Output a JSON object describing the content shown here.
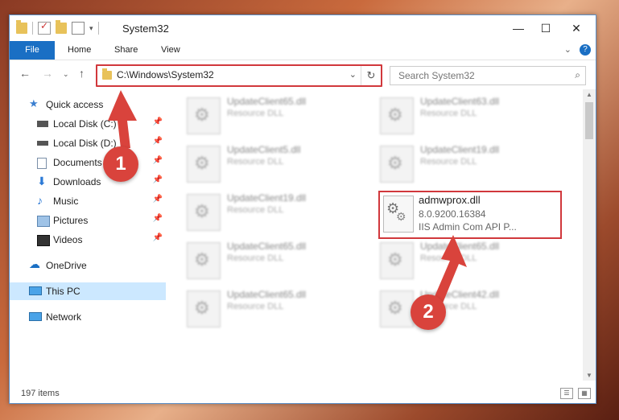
{
  "window": {
    "title": "System32",
    "controls": {
      "minimize": "—",
      "maximize": "☐",
      "close": "✕"
    }
  },
  "ribbon": {
    "tabs": [
      "File",
      "Home",
      "Share",
      "View"
    ],
    "help_label": "?"
  },
  "address": {
    "path": "C:\\Windows\\System32",
    "search_placeholder": "Search System32"
  },
  "sidebar": {
    "quick_access": "Quick access",
    "items": [
      {
        "label": "Local Disk (C:)",
        "icon": "drive-icon"
      },
      {
        "label": "Local Disk (D:)",
        "icon": "drive-icon"
      },
      {
        "label": "Documents",
        "icon": "documents-icon"
      },
      {
        "label": "Downloads",
        "icon": "download-icon"
      },
      {
        "label": "Music",
        "icon": "music-icon"
      },
      {
        "label": "Pictures",
        "icon": "pictures-icon"
      },
      {
        "label": "Videos",
        "icon": "videos-icon"
      }
    ],
    "onedrive": "OneDrive",
    "this_pc": "This PC",
    "network": "Network"
  },
  "files": [
    {
      "name": "UpdateClient65.dll",
      "desc": "Resource DLL"
    },
    {
      "name": "UpdateClient63.dll",
      "desc": "Resource DLL"
    },
    {
      "name": "UpdateClient5.dll",
      "desc": "Resource DLL"
    },
    {
      "name": "UpdateClient19.dll",
      "desc": "Resource DLL"
    },
    {
      "name": "UpdateClient19.dll",
      "desc": "Resource DLL"
    },
    {
      "name": "UpdateClient65.dll",
      "desc": "Resource DLL"
    },
    {
      "name": "UpdateClient65.dll",
      "desc": "Resource DLL"
    },
    {
      "name": "UpdateClient65.dll",
      "desc": "Resource DLL"
    },
    {
      "name": "UpdateClient42.dll",
      "desc": "Resource DLL"
    }
  ],
  "highlighted_file": {
    "name": "admwprox.dll",
    "version": "8.0.9200.16384",
    "description": "IIS Admin Com API P..."
  },
  "status": {
    "item_count": "197 items"
  },
  "annotations": {
    "step1": "1",
    "step2": "2"
  },
  "colors": {
    "accent": "#1a6fc4",
    "highlight": "#d1383c",
    "selected": "#cce8ff"
  }
}
